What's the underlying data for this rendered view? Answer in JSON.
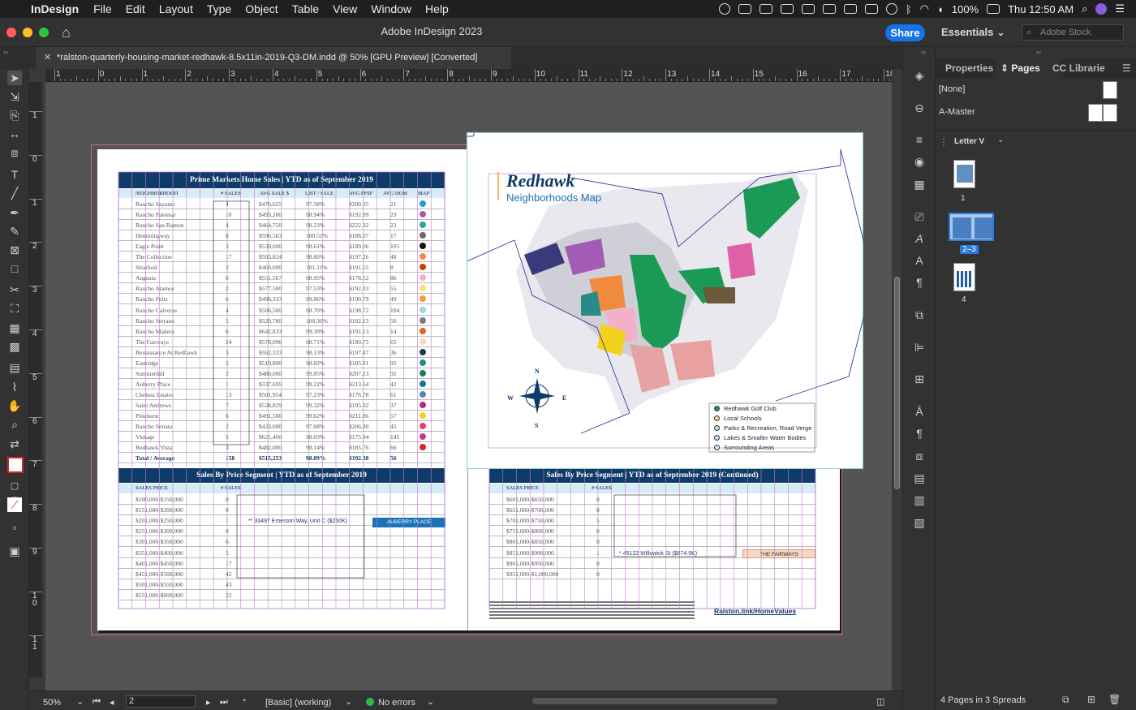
{
  "menubar": {
    "app": "InDesign",
    "items": [
      "File",
      "Edit",
      "Layout",
      "Type",
      "Object",
      "Table",
      "View",
      "Window",
      "Help"
    ],
    "battery": "100%",
    "clock": "Thu 12:50 AM"
  },
  "titlebar": {
    "title": "Adobe InDesign 2023",
    "share": "Share",
    "workspace": "Essentials",
    "stock_placeholder": "Adobe Stock"
  },
  "document_tab": "*ralston-quarterly-housing-market-redhawk-8.5x11in-2019-Q3-DM.indd @ 50% [GPU Preview] [Converted]",
  "ruler": {
    "top_numbers": [
      "1",
      "0",
      "1",
      "2",
      "3",
      "4",
      "5",
      "6",
      "7",
      "8",
      "9",
      "10",
      "11",
      "12",
      "13",
      "14",
      "15",
      "16",
      "17",
      "18"
    ],
    "left_numbers": [
      "1",
      "0",
      "1",
      "2",
      "3",
      "4",
      "5",
      "6",
      "7",
      "8",
      "9",
      "1\n0",
      "1\n1"
    ]
  },
  "prime_table": {
    "title": "Prime Markets Home Sales  |  YTD as of September 2019",
    "columns": [
      "NEIGHBORHOOD",
      "# SALES",
      "AVG SALE $",
      "LIST / SALE",
      "AVG PPSF",
      "AVG DOM",
      "MAP"
    ],
    "rows": [
      {
        "n": "Rancho Sayante",
        "s": "4",
        "a": "$476,625",
        "l": "97.58%",
        "p": "$200.35",
        "d": "21",
        "c": "#1b9fd6"
      },
      {
        "n": "Rancho Palomar",
        "s": "10",
        "a": "$493,200",
        "l": "98.94%",
        "p": "$192.89",
        "d": "23",
        "c": "#a35bb5"
      },
      {
        "n": "Rancho San Ramon",
        "s": "4",
        "a": "$464,750",
        "l": "98.23%",
        "p": "$222.32",
        "p2": "",
        "d": "23",
        "c": "#2aa59a"
      },
      {
        "n": "Hemmingway",
        "s": "8",
        "a": "$596,563",
        "l": "100.51%",
        "p": "$188.07",
        "d": "17",
        "c": "#6b6b6b"
      },
      {
        "n": "Eagle Point",
        "s": "3",
        "a": "$530,000",
        "l": "98.61%",
        "p": "$189.06",
        "d": "105",
        "c": "#111111"
      },
      {
        "n": "The Collection",
        "s": "17",
        "a": "$503,824",
        "l": "98.80%",
        "p": "$197.26",
        "d": "48",
        "c": "#f08a3c"
      },
      {
        "n": "Stratford",
        "s": "2",
        "a": "$469,000",
        "l": "101.11%",
        "p": "$191.55",
        "d": "8",
        "c": "#c2410c"
      },
      {
        "n": "Augusta",
        "s": "6",
        "a": "$551,567",
        "l": "98.95%",
        "p": "$178.52",
        "d": "86",
        "c": "#f3b0c8"
      },
      {
        "n": "Rancho Alamos",
        "s": "2",
        "a": "$577,500",
        "l": "97.53%",
        "p": "$192.33",
        "d": "55",
        "c": "#f5e07a"
      },
      {
        "n": "Rancho Feliz",
        "s": "6",
        "a": "$496,333",
        "l": "99.86%",
        "p": "$190.79",
        "d": "49",
        "c": "#f0a030"
      },
      {
        "n": "Rancho Calveras",
        "s": "4",
        "a": "$506,500",
        "l": "98.70%",
        "p": "$198.72",
        "d": "104",
        "c": "#9fd3e8"
      },
      {
        "n": "Rancho Serrano",
        "s": "5",
        "a": "$520,780",
        "l": "100.30%",
        "p": "$182.23",
        "d": "50",
        "c": "#7d7d7d"
      },
      {
        "n": "Rancho Madera",
        "s": "6",
        "a": "$642,833",
        "l": "99.39%",
        "p": "$191.13",
        "d": "14",
        "c": "#e5622a"
      },
      {
        "n": "The Fairways",
        "s": "24",
        "a": "$578,096",
        "l": "98.71%",
        "p": "$180.75",
        "d": "65",
        "c": "#f7d9b0"
      },
      {
        "n": "Renaissance At Redhawk",
        "s": "3",
        "a": "$562,333",
        "l": "98.13%",
        "p": "$197.47",
        "d": "36",
        "c": "#1e3a5f"
      },
      {
        "n": "Eastridge",
        "s": "5",
        "a": "$519,800",
        "l": "98.82%",
        "p": "$185.81",
        "d": "95",
        "c": "#2a8a8a"
      },
      {
        "n": "Summerhill",
        "s": "2",
        "a": "$480,000",
        "l": "99.85%",
        "p": "$207.23",
        "d": "92",
        "c": "#1f7a5a"
      },
      {
        "n": "Auberry Place",
        "s": "1",
        "a": "$337,695",
        "l": "99.22%",
        "p": "$213.64",
        "d": "42",
        "c": "#117a8b"
      },
      {
        "n": "Chelsea Estates",
        "s": "13",
        "a": "$501,954",
        "l": "97.23%",
        "p": "$176.78",
        "d": "61",
        "c": "#5a7fc0"
      },
      {
        "n": "Saint Andrews",
        "s": "7",
        "a": "$538,829",
        "l": "99.32%",
        "p": "$195.92",
        "d": "37",
        "c": "#b5287a"
      },
      {
        "n": "Pinehurst",
        "s": "6",
        "a": "$491,500",
        "l": "99.62%",
        "p": "$211.86",
        "d": "57",
        "c": "#f2d21b"
      },
      {
        "n": "Rancho Sonata",
        "s": "2",
        "a": "$423,000",
        "l": "97.68%",
        "p": "$206.80",
        "d": "45",
        "c": "#e53e6a"
      },
      {
        "n": "Vintage",
        "s": "5",
        "a": "$621,400",
        "l": "98.03%",
        "p": "$175.94",
        "d": "145",
        "c": "#c43c8a"
      },
      {
        "n": "Redhawk Vista",
        "s": "3",
        "a": "$482,000",
        "l": "98.14%",
        "p": "$185.76",
        "d": "66",
        "c": "#d62828"
      }
    ],
    "total": {
      "n": "Total / Average",
      "s": "158",
      "a": "$515,253",
      "l": "98.89%",
      "p": "$192.38",
      "d": "56"
    }
  },
  "price_table_left": {
    "title": "Sales By Price Segment  |  YTD as of September 2019",
    "columns": [
      "SALES PRICE",
      "# SALES"
    ],
    "rows": [
      {
        "r": "$100,000-$150,000",
        "s": "0"
      },
      {
        "r": "$151,000-$200,000",
        "s": "0"
      },
      {
        "r": "$201,000-$250,000",
        "s": "1"
      },
      {
        "r": "$251,000-$300,000",
        "s": "0"
      },
      {
        "r": "$301,000-$350,000",
        "s": "6"
      },
      {
        "r": "$351,000-$400,000",
        "s": "5"
      },
      {
        "r": "$401,000-$450,000",
        "s": "17"
      },
      {
        "r": "$451,000-$500,000",
        "s": "42"
      },
      {
        "r": "$501,000-$550,000",
        "s": "43"
      },
      {
        "r": "$551,000-$600,000",
        "s": "22"
      }
    ],
    "callout": "** 33497 Emerson Way, Unit C ($250K)",
    "tag": "AUBERRY PLACE"
  },
  "price_table_right": {
    "title": "Sales By Price Segment  |  YTD as of September 2019 (Continued)",
    "columns": [
      "SALES PRICE",
      "# SALES"
    ],
    "rows": [
      {
        "r": "$601,000-$650,000",
        "s": "8"
      },
      {
        "r": "$651,000-$700,000",
        "s": "8"
      },
      {
        "r": "$701,000-$750,000",
        "s": "5"
      },
      {
        "r": "$751,000-$800,000",
        "s": "0"
      },
      {
        "r": "$801,000-$850,000",
        "s": "0"
      },
      {
        "r": "$851,000-$900,000",
        "s": "1"
      },
      {
        "r": "$901,000-$950,000",
        "s": "0"
      },
      {
        "r": "$951,000-$1,000,000",
        "s": "0"
      }
    ],
    "callout": "* 45122 Willowick St ($874.9K)",
    "tag": "THE FAIRWAYS",
    "footer_link": "Ralston.link/HomeValues"
  },
  "map": {
    "title": "Redhawk",
    "subtitle": "Neighborhoods Map",
    "compass": [
      "N",
      "W",
      "E",
      "S"
    ],
    "legend": [
      {
        "label": "Redhawk Golf Club",
        "color": "#1a9a55"
      },
      {
        "label": "Local Schools",
        "color": "#f3d38a"
      },
      {
        "label": "Parks & Recreation, Road Verge",
        "color": "#c9e6b0"
      },
      {
        "label": "Lakes & Smaller Water Bodies",
        "color": "#bfe3f3"
      },
      {
        "label": "Surrounding Areas",
        "color": "#e3e3f0"
      }
    ]
  },
  "panel": {
    "tabs": [
      "Properties",
      "Pages",
      "CC Librarie"
    ],
    "masters": [
      "[None]",
      "A-Master"
    ],
    "size_label": "Letter V",
    "pages": [
      "1",
      "2–3",
      "4"
    ],
    "footer": "4 Pages in 3 Spreads"
  },
  "status": {
    "zoom": "50%",
    "page": "2",
    "preflight_profile": "[Basic] (working)",
    "errors": "No errors"
  }
}
